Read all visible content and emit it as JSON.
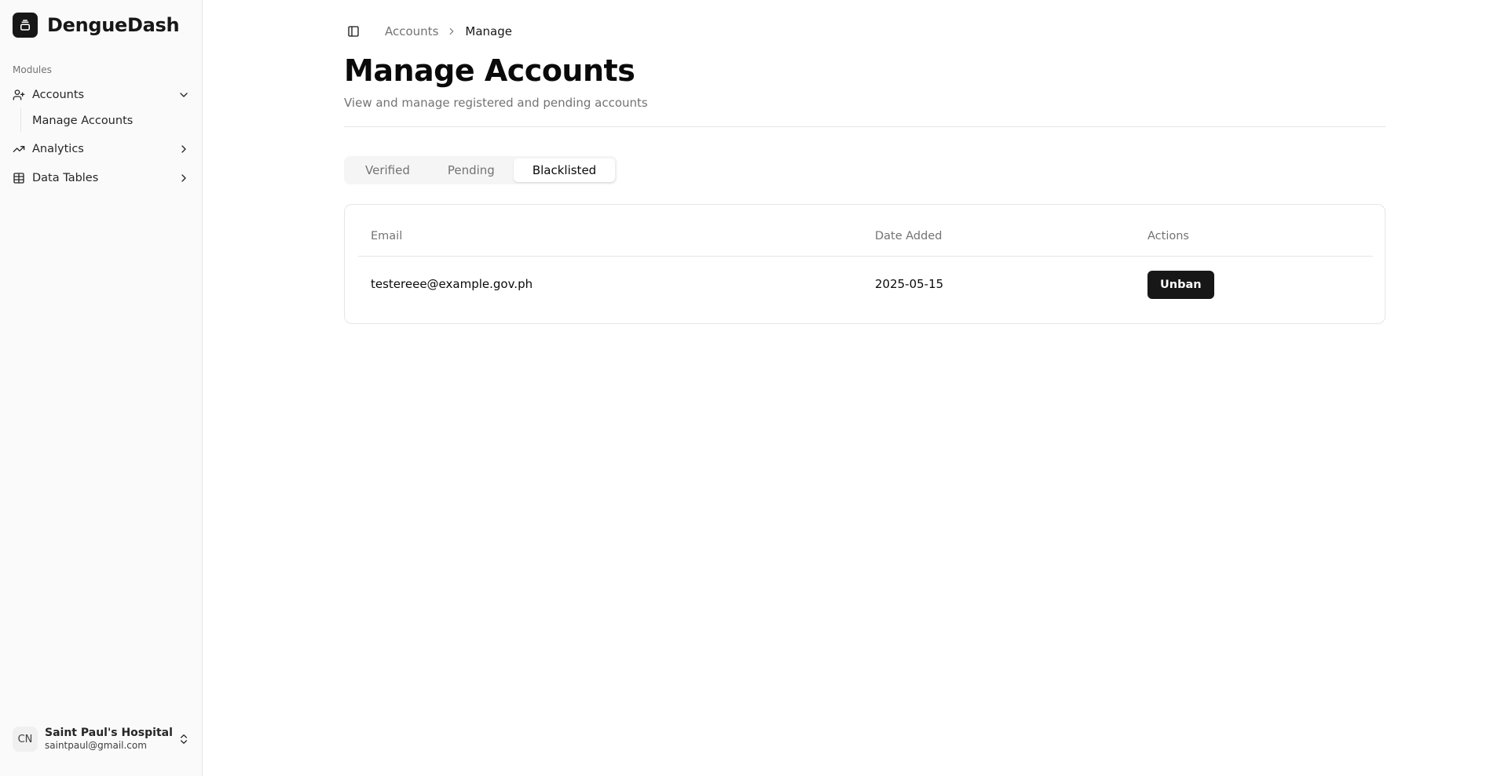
{
  "app": {
    "name": "DengueDash"
  },
  "sidebar": {
    "group_label": "Modules",
    "items": [
      {
        "label": "Accounts",
        "icon": "user-plus-icon",
        "expanded": true
      },
      {
        "label": "Analytics",
        "icon": "trend-icon",
        "expanded": false
      },
      {
        "label": "Data Tables",
        "icon": "table-icon",
        "expanded": false
      }
    ],
    "sub_items": [
      {
        "label": "Manage Accounts"
      }
    ],
    "user": {
      "initials": "CN",
      "name": "Saint Paul's Hospital",
      "email": "saintpaul@gmail.com"
    }
  },
  "breadcrumb": {
    "parent": "Accounts",
    "current": "Manage"
  },
  "page": {
    "title": "Manage Accounts",
    "subtitle": "View and manage registered and pending accounts"
  },
  "tabs": [
    {
      "label": "Verified",
      "active": false
    },
    {
      "label": "Pending",
      "active": false
    },
    {
      "label": "Blacklisted",
      "active": true
    }
  ],
  "table": {
    "columns": [
      "Email",
      "Date Added",
      "Actions"
    ],
    "rows": [
      {
        "email": "testereee@example.gov.ph",
        "date_added": "2025-05-15",
        "action_label": "Unban"
      }
    ]
  },
  "colors": {
    "accent": "#171717",
    "muted": "#737373",
    "border": "#e5e5e5",
    "sidebar_bg": "#fafafa"
  }
}
